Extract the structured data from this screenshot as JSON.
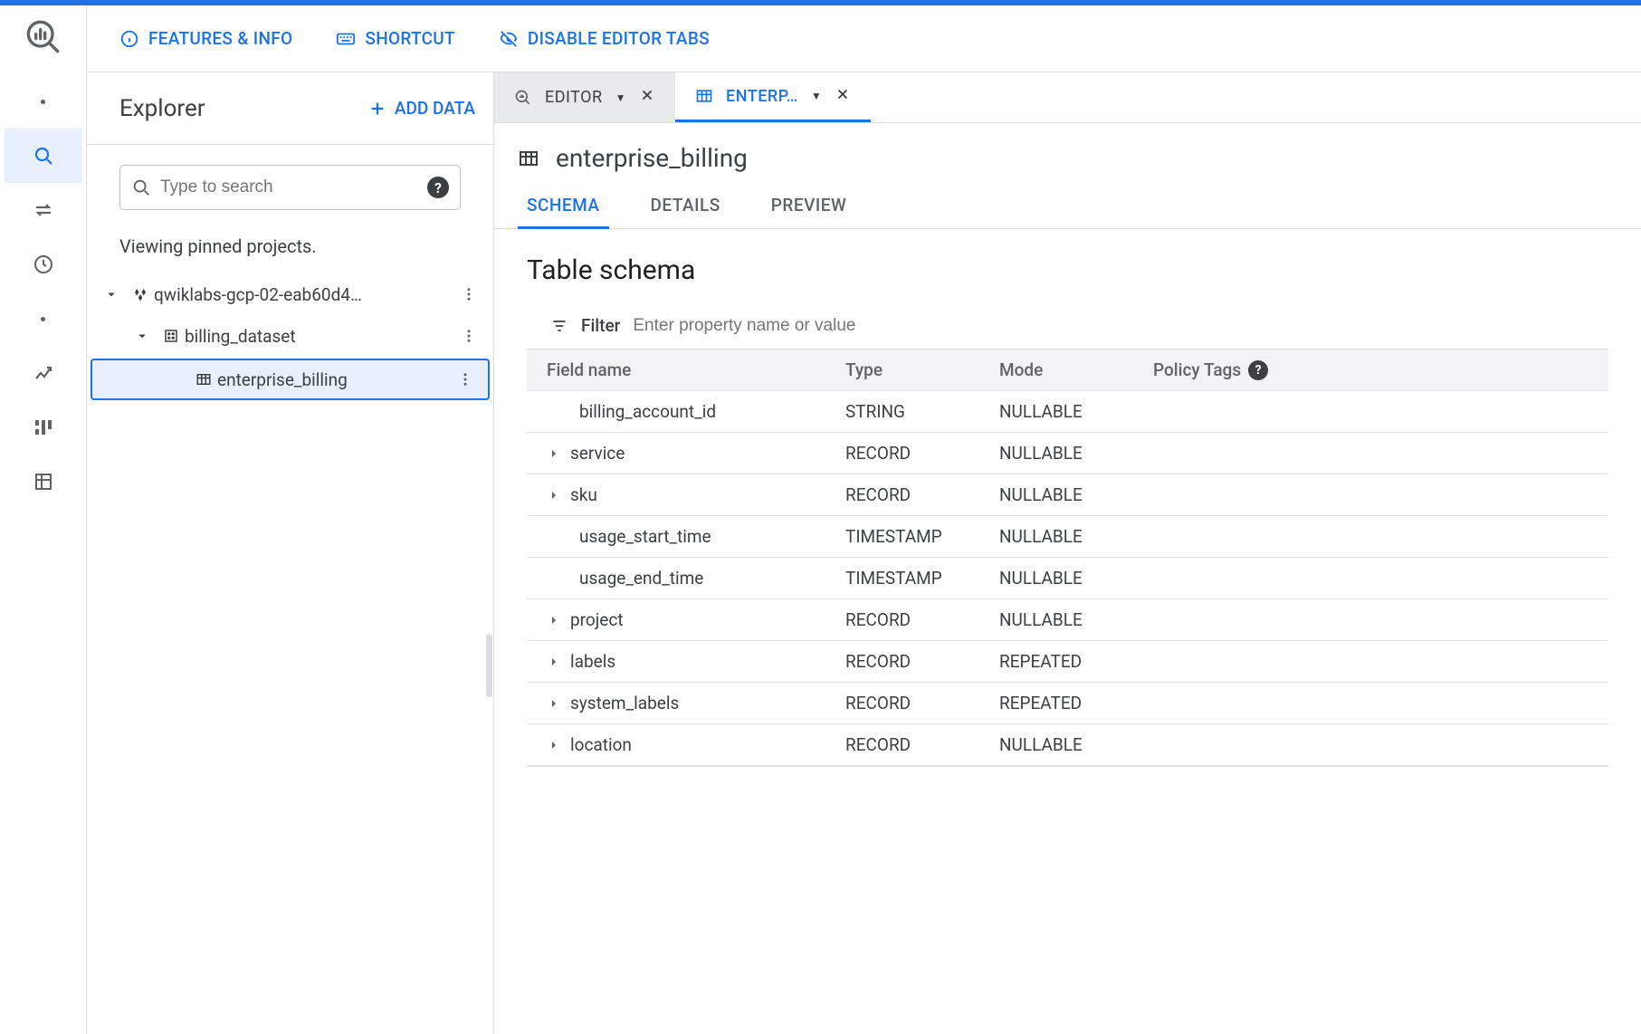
{
  "toolbar": {
    "features": "FEATURES & INFO",
    "shortcut": "SHORTCUT",
    "disable_tabs": "DISABLE EDITOR TABS"
  },
  "explorer": {
    "title": "Explorer",
    "add_data": "ADD DATA",
    "search_placeholder": "Type to search",
    "pinned_text": "Viewing pinned projects.",
    "tree": {
      "project": "qwiklabs-gcp-02-eab60d4…",
      "dataset": "billing_dataset",
      "table": "enterprise_billing"
    }
  },
  "editor_tabs": {
    "editor": "EDITOR",
    "active": "ENTERP…"
  },
  "table": {
    "name": "enterprise_billing",
    "tabs": {
      "schema": "SCHEMA",
      "details": "DETAILS",
      "preview": "PREVIEW"
    },
    "schema_heading": "Table schema",
    "filter_label": "Filter",
    "filter_placeholder": "Enter property name or value",
    "columns": {
      "field": "Field name",
      "type": "Type",
      "mode": "Mode",
      "policy": "Policy Tags"
    },
    "fields": [
      {
        "name": "billing_account_id",
        "type": "STRING",
        "mode": "NULLABLE",
        "expandable": false
      },
      {
        "name": "service",
        "type": "RECORD",
        "mode": "NULLABLE",
        "expandable": true
      },
      {
        "name": "sku",
        "type": "RECORD",
        "mode": "NULLABLE",
        "expandable": true
      },
      {
        "name": "usage_start_time",
        "type": "TIMESTAMP",
        "mode": "NULLABLE",
        "expandable": false
      },
      {
        "name": "usage_end_time",
        "type": "TIMESTAMP",
        "mode": "NULLABLE",
        "expandable": false
      },
      {
        "name": "project",
        "type": "RECORD",
        "mode": "NULLABLE",
        "expandable": true
      },
      {
        "name": "labels",
        "type": "RECORD",
        "mode": "REPEATED",
        "expandable": true
      },
      {
        "name": "system_labels",
        "type": "RECORD",
        "mode": "REPEATED",
        "expandable": true
      },
      {
        "name": "location",
        "type": "RECORD",
        "mode": "NULLABLE",
        "expandable": true
      }
    ]
  }
}
